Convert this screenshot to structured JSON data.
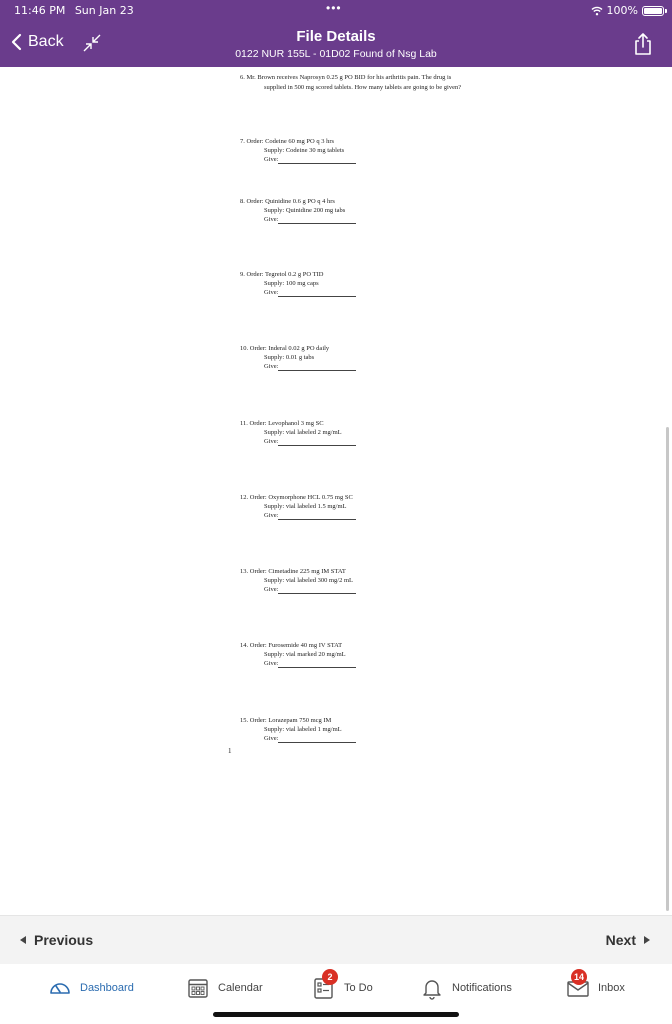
{
  "status": {
    "time": "11:46 PM",
    "date": "Sun Jan 23",
    "battery": "100%",
    "battery_level": 1.0
  },
  "header": {
    "back_label": "Back",
    "title": "File Details",
    "subtitle": "0122 NUR 155L - 01D02 Found of Nsg Lab",
    "color": "#6a3c8c"
  },
  "document": {
    "q6_line1": "6. Mr. Brown receives Naprosyn 0.25 g PO BID for his arthritis pain. The drug is",
    "q6_line2": "supplied in 500 mg scored tablets. How many tablets are going to be given?",
    "questions": [
      {
        "order": "7. Order: Codeine 60 mg PO q 3 hrs",
        "supply": "Supply: Codeine 30 mg tablets",
        "give": "Give:"
      },
      {
        "order": "8. Order: Quinidine 0.6 g PO q 4 hrs",
        "supply": "Supply: Quinidine 200 mg tabs",
        "give": "Give:"
      },
      {
        "order": "9. Order: Tegretol 0.2 g PO TID",
        "supply": "Supply: 100 mg caps",
        "give": "Give:"
      },
      {
        "order": "10. Order: Inderal 0.02 g PO daily",
        "supply": "Supply: 0.01 g tabs",
        "give": "Give:"
      },
      {
        "order": "11. Order: Levophanol 3 mg SC",
        "supply": "Supply: vial labeled 2 mg/mL",
        "give": "Give:"
      },
      {
        "order": "12. Order: Oxymorphone HCL 0.75 mg SC",
        "supply": "Supply: vial labeled 1.5 mg/mL",
        "give": "Give:"
      },
      {
        "order": "13. Order: Cimetadine 225 mg IM STAT",
        "supply": "Supply: vial labeled 300 mg/2 mL",
        "give": "Give:"
      },
      {
        "order": "14. Order: Furosemide 40 mg IV STAT",
        "supply": "Supply: vial marked 20 mg/mL",
        "give": "Give:"
      },
      {
        "order": "15. Order: Lorazepam 750 mcg IM",
        "supply": "Supply: vial labeled 1 mg/mL",
        "give": "Give:"
      }
    ],
    "page_mark": "1"
  },
  "pager": {
    "previous": "Previous",
    "next": "Next"
  },
  "tabs": {
    "dashboard": "Dashboard",
    "calendar": "Calendar",
    "todo": "To Do",
    "todo_badge": "2",
    "notifications": "Notifications",
    "inbox": "Inbox",
    "inbox_badge": "14"
  }
}
